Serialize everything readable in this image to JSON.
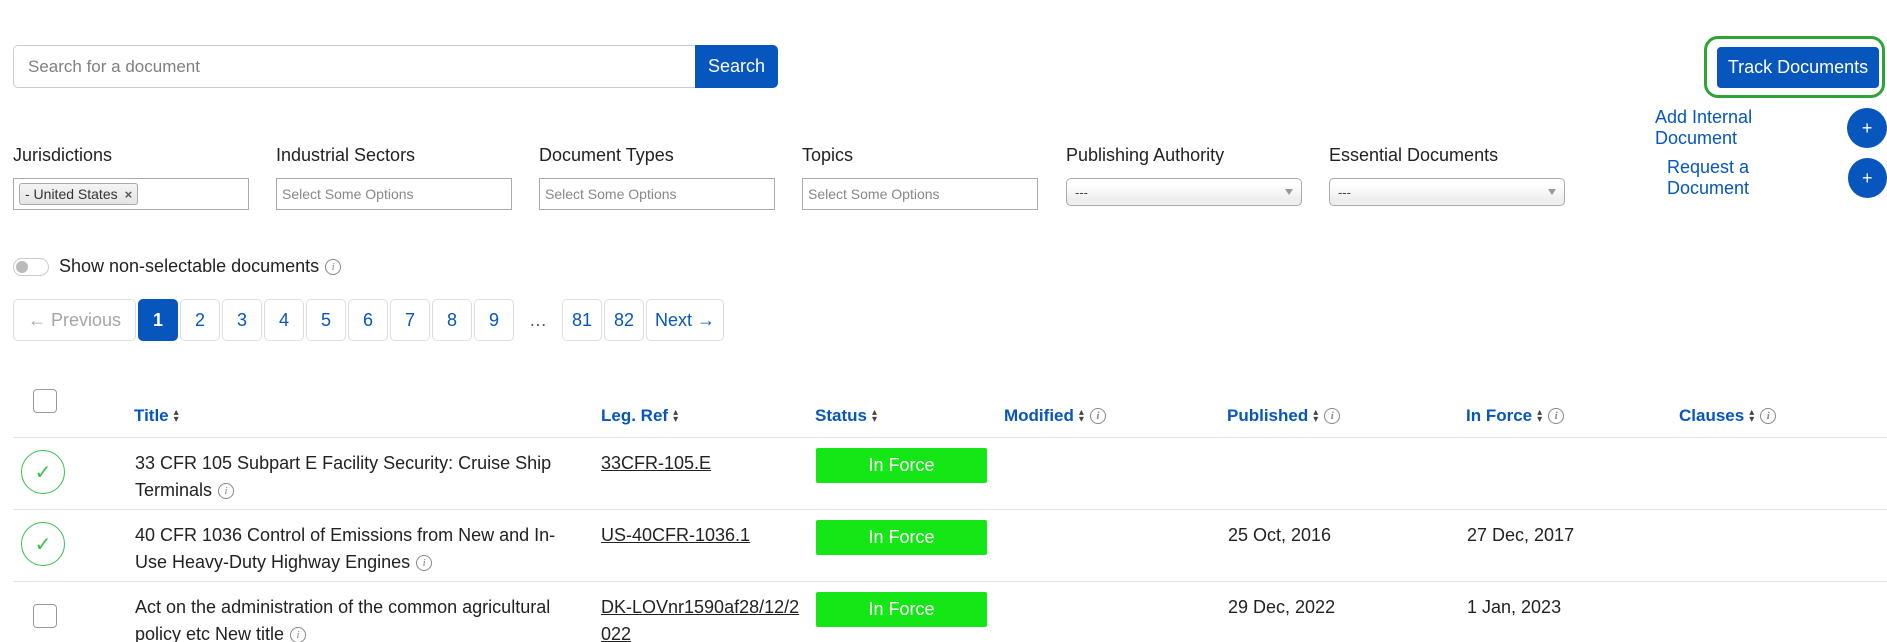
{
  "search": {
    "placeholder": "Search for a document",
    "button_label": "Search"
  },
  "actions": {
    "track_label": "Track Documents",
    "add_internal_label": "Add Internal Document",
    "request_label": "Request a Document",
    "plus_symbol": "+"
  },
  "filters": {
    "jurisdictions": {
      "label": "Jurisdictions",
      "chip": "- United States",
      "chip_remove": "×"
    },
    "sectors": {
      "label": "Industrial Sectors",
      "placeholder": "Select Some Options"
    },
    "doc_types": {
      "label": "Document Types",
      "placeholder": "Select Some Options"
    },
    "topics": {
      "label": "Topics",
      "placeholder": "Select Some Options"
    },
    "authority": {
      "label": "Publishing Authority",
      "value": "---"
    },
    "essential": {
      "label": "Essential Documents",
      "value": "---"
    }
  },
  "toggle": {
    "label": "Show non-selectable documents",
    "info": "i"
  },
  "pagination": {
    "previous": "← Previous",
    "next": "Next →",
    "pages": [
      "1",
      "2",
      "3",
      "4",
      "5",
      "6",
      "7",
      "8",
      "9",
      "…",
      "81",
      "82"
    ],
    "active": "1"
  },
  "table": {
    "headers": {
      "title": "Title",
      "ref": "Leg. Ref",
      "status": "Status",
      "modified": "Modified",
      "published": "Published",
      "in_force": "In Force",
      "clauses": "Clauses"
    },
    "rows": [
      {
        "selected": true,
        "title": "33 CFR 105 Subpart E Facility Security: Cruise Ship Terminals",
        "ref": "33CFR-105.E",
        "status": "In Force",
        "published": "",
        "in_force": ""
      },
      {
        "selected": true,
        "title": "40 CFR 1036 Control of Emissions from New and In-Use Heavy-Duty Highway Engines",
        "ref": "US-40CFR-1036.1",
        "status": "In Force",
        "published": "25 Oct, 2016",
        "in_force": "27 Dec, 2017"
      },
      {
        "selected": false,
        "title": "Act on the administration of the common agricultural policy etc New title",
        "ref": "DK-LOVnr1590af28/12/2022",
        "status": "In Force",
        "published": "29 Dec, 2022",
        "in_force": "1 Jan, 2023"
      }
    ]
  },
  "colors": {
    "primary": "#0656be",
    "status_green": "#15e615",
    "highlight_outline": "#2ea336",
    "check_green": "#3bbf4a"
  },
  "icons": {
    "check": "✓",
    "sort": "sort-arrows-icon",
    "info": "info-icon"
  }
}
